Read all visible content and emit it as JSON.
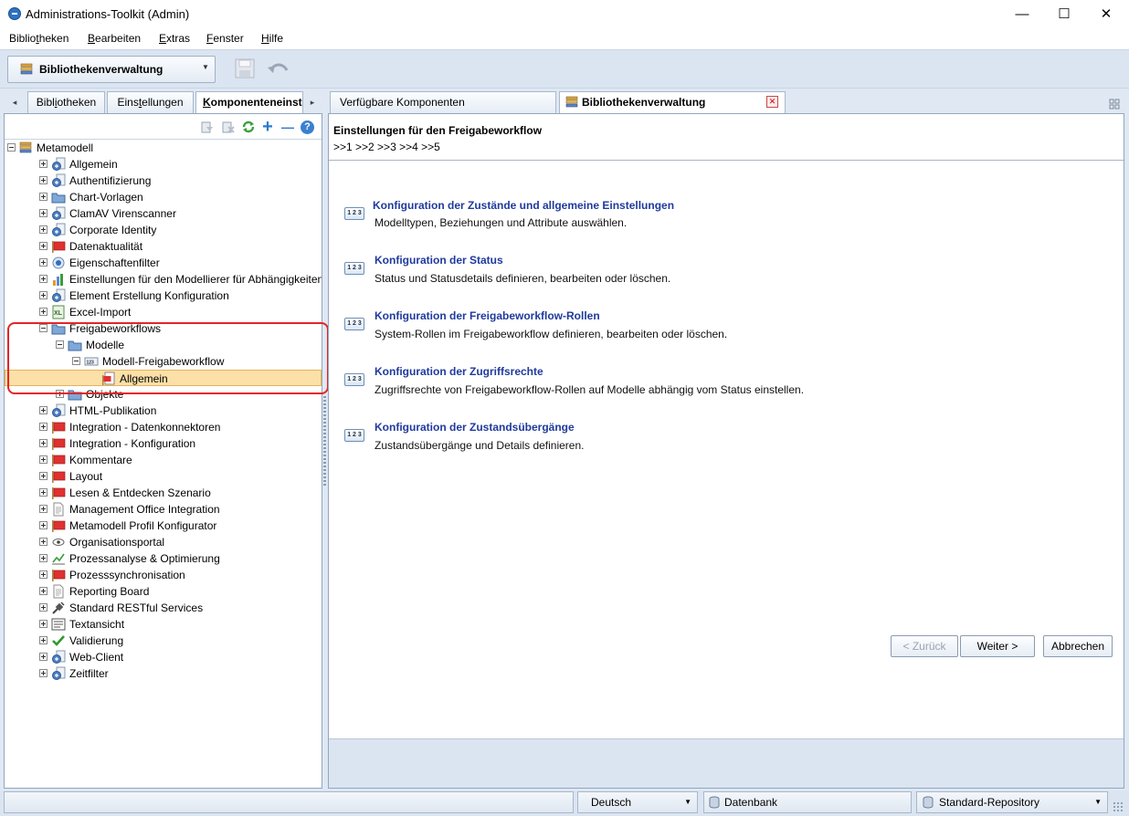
{
  "window": {
    "title": "Administrations-Toolkit (Admin)",
    "controls": {
      "minimize": "—",
      "maximize": "☐",
      "close": "✕"
    }
  },
  "menu": {
    "items": [
      {
        "pre": "Biblio",
        "u": "t",
        "post": "heken"
      },
      {
        "pre": "",
        "u": "B",
        "post": "earbeiten"
      },
      {
        "pre": "",
        "u": "E",
        "post": "xtras"
      },
      {
        "pre": "",
        "u": "F",
        "post": "enster"
      },
      {
        "pre": "",
        "u": "H",
        "post": "ilfe"
      }
    ]
  },
  "toolbar": {
    "view_selector": "Bibliothekenverwaltung",
    "save_icon": "save-icon",
    "undo_icon": "undo-icon"
  },
  "left_tabs": {
    "scroll_left": "◂",
    "scroll_right": "▸",
    "tabs": [
      {
        "pre": "Bibl",
        "u": "i",
        "post": "otheken",
        "active": false
      },
      {
        "pre": "Eins",
        "u": "t",
        "post": "ellungen",
        "active": false
      },
      {
        "pre": "",
        "u": "K",
        "post": "omponenteneinst",
        "active": true
      }
    ]
  },
  "left_toolbar": {
    "icons": [
      "filter-icon",
      "filter-clear-icon",
      "refresh-icon",
      "add-icon",
      "remove-icon",
      "help-icon"
    ],
    "add": "+",
    "remove": "—",
    "help": "?"
  },
  "tree": {
    "root": "Metamodell",
    "items": [
      {
        "label": "Allgemein",
        "icon": "component-icon"
      },
      {
        "label": "Authentifizierung",
        "icon": "component-icon"
      },
      {
        "label": "Chart-Vorlagen",
        "icon": "folder-icon"
      },
      {
        "label": "ClamAV Virenscanner",
        "icon": "component-icon"
      },
      {
        "label": "Corporate Identity",
        "icon": "component-icon"
      },
      {
        "label": "Datenaktualität",
        "icon": "flag-icon"
      },
      {
        "label": "Eigenschaftenfilter",
        "icon": "target-icon"
      },
      {
        "label": "Einstellungen für den Modellierer für Abhängigkeiten",
        "icon": "chart-icon"
      },
      {
        "label": "Element Erstellung Konfiguration",
        "icon": "component-icon"
      },
      {
        "label": "Excel-Import",
        "icon": "excel-icon"
      }
    ],
    "freigabe": {
      "label": "Freigabeworkflows",
      "modelle": "Modelle",
      "modell_freigabe": "Modell-Freigabeworkflow",
      "allgemein": "Allgemein",
      "objekte": "Objekte"
    },
    "items_after": [
      {
        "label": "HTML-Publikation",
        "icon": "component-icon"
      },
      {
        "label": "Integration - Datenkonnektoren",
        "icon": "flag-icon"
      },
      {
        "label": "Integration - Konfiguration",
        "icon": "flag-icon"
      },
      {
        "label": "Kommentare",
        "icon": "flag-icon"
      },
      {
        "label": "Layout",
        "icon": "flag-icon"
      },
      {
        "label": "Lesen & Entdecken Szenario",
        "icon": "flag-icon"
      },
      {
        "label": "Management Office Integration",
        "icon": "document-icon"
      },
      {
        "label": "Metamodell Profil Konfigurator",
        "icon": "flag-icon"
      },
      {
        "label": "Organisationsportal",
        "icon": "eye-icon"
      },
      {
        "label": "Prozessanalyse & Optimierung",
        "icon": "line-chart-icon"
      },
      {
        "label": "Prozesssynchronisation",
        "icon": "flag-icon"
      },
      {
        "label": "Reporting Board",
        "icon": "document-icon"
      },
      {
        "label": "Standard RESTful Services",
        "icon": "plug-icon"
      },
      {
        "label": "Textansicht",
        "icon": "text-icon"
      },
      {
        "label": "Validierung",
        "icon": "check-icon"
      },
      {
        "label": "Web-Client",
        "icon": "component-icon"
      },
      {
        "label": "Zeitfilter",
        "icon": "component-icon"
      }
    ]
  },
  "right_tabs": {
    "available": "Verfügbare Komponenten",
    "library_admin": "Bibliothekenverwaltung",
    "close": "✕",
    "layout_icon": "layout-icon"
  },
  "wizard": {
    "heading": "Einstellungen für den Freigabeworkflow",
    "steps_line": ">>1 >>2 >>3 >>4 >>5",
    "step_icon_text": "1 2 3",
    "steps": [
      {
        "title": "Konfiguration der Zustände und allgemeine Einstellungen",
        "desc": "Modelltypen, Beziehungen und Attribute auswählen."
      },
      {
        "title": "Konfiguration der Status",
        "desc": "Status und Statusdetails definieren, bearbeiten oder löschen."
      },
      {
        "title": "Konfiguration der Freigabeworkflow-Rollen",
        "desc": "System-Rollen im Freigabeworkflow definieren, bearbeiten oder löschen."
      },
      {
        "title": "Konfiguration der Zugriffsrechte",
        "desc": "Zugriffsrechte von Freigabeworkflow-Rollen auf Modelle abhängig vom Status einstellen."
      },
      {
        "title": "Konfiguration der Zustandsübergänge",
        "desc": "Zustandsübergänge und Details definieren."
      }
    ],
    "buttons": {
      "back": "< Zurück",
      "next": "Weiter >",
      "cancel": "Abbrechen"
    }
  },
  "status": {
    "language": "Deutsch",
    "database": "Datenbank",
    "repository": "Standard-Repository"
  },
  "colors": {
    "accent": "#1f3a9c",
    "selection": "#fbe0a8",
    "highlight_border": "#e52424",
    "flag": "#e03030",
    "folder": "#7fa8d8"
  }
}
